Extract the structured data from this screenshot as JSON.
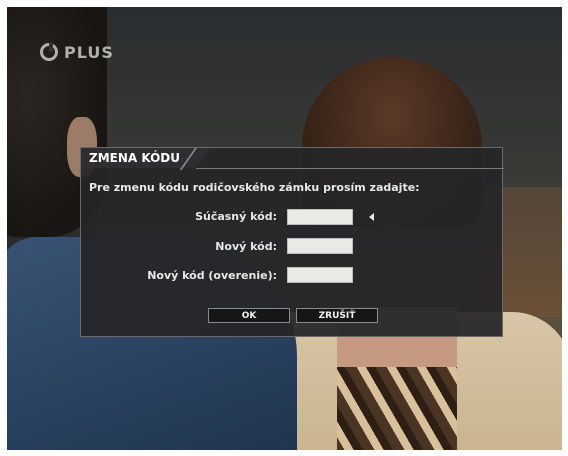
{
  "channel": {
    "logo_text": "PLUS"
  },
  "dialog": {
    "title": "ZMENA KÓDU",
    "prompt": "Pre zmenu kódu rodičovského zámku prosím zadajte:",
    "fields": [
      {
        "label": "Súčasný kód:",
        "value": ""
      },
      {
        "label": "Nový kód:",
        "value": ""
      },
      {
        "label": "Nový kód (overenie):",
        "value": ""
      }
    ],
    "buttons": {
      "ok": "OK",
      "cancel": "ZRUŠIŤ"
    }
  },
  "colors": {
    "dialog_bg": "#262628",
    "field_bg": "#e9e9e6",
    "text": "#e8e8e8"
  }
}
